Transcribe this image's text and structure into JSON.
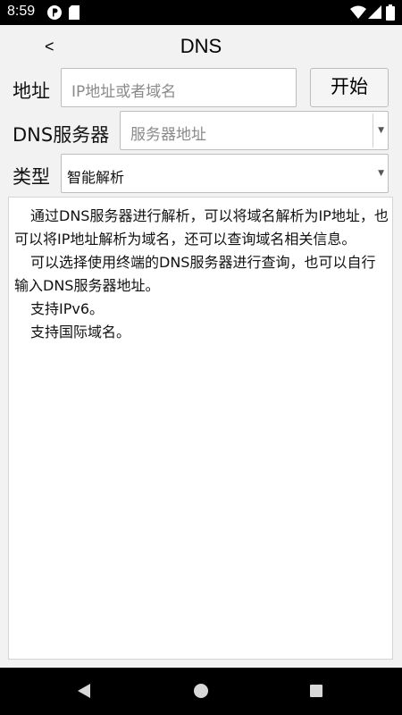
{
  "status_bar": {
    "time": "8:59",
    "icons": [
      "notification-p-icon",
      "sd-card-icon",
      "wifi-icon",
      "signal-icon",
      "battery-icon"
    ]
  },
  "header": {
    "back_label": "<",
    "title": "DNS"
  },
  "address_row": {
    "label": "地址",
    "placeholder": "IP地址或者域名",
    "start_button": "开始"
  },
  "dns_server_row": {
    "label": "DNS服务器",
    "placeholder": "服务器地址"
  },
  "type_row": {
    "label": "类型",
    "selected": "智能解析"
  },
  "info": {
    "paragraphs": [
      "通过DNS服务器进行解析，可以将域名解析为IP地址，也可以将IP地址解析为域名，还可以查询域名相关信息。",
      "可以选择使用终端的DNS服务器进行查询，也可以自行输入DNS服务器地址。",
      "支持IPv6。",
      "支持国际域名。"
    ]
  },
  "colors": {
    "background": "#f2f2f2",
    "system_bars": "#000000"
  }
}
